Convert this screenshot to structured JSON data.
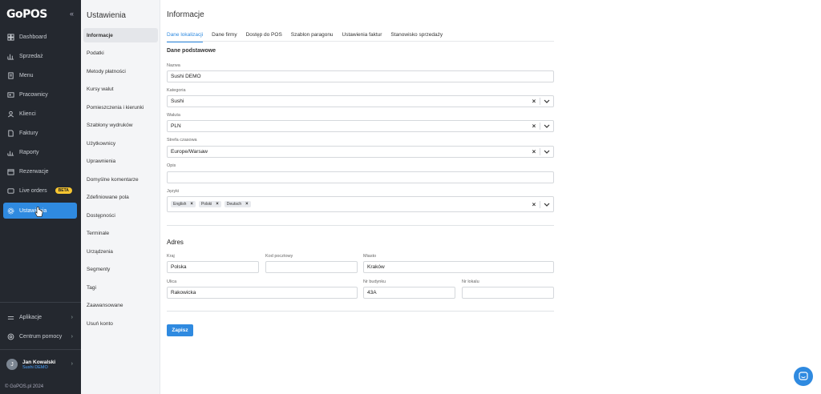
{
  "brand": {
    "logo": "GoPOS",
    "collapse": "«"
  },
  "nav": {
    "items": [
      {
        "label": "Dashboard",
        "icon": "dashboard-icon"
      },
      {
        "label": "Sprzedaż",
        "icon": "chart-icon"
      },
      {
        "label": "Menu",
        "icon": "menu-icon"
      },
      {
        "label": "Pracownicy",
        "icon": "users-icon"
      },
      {
        "label": "Klienci",
        "icon": "user-icon"
      },
      {
        "label": "Faktury",
        "icon": "invoice-icon"
      },
      {
        "label": "Raporty",
        "icon": "report-icon"
      },
      {
        "label": "Rezerwacje",
        "icon": "calendar-icon"
      },
      {
        "label": "Live orders",
        "icon": "orders-icon",
        "badge": "BETA"
      },
      {
        "label": "Ustawienia",
        "icon": "gear-icon",
        "active": true
      }
    ],
    "bottom": [
      {
        "label": "Aplikacje",
        "icon": "apps-icon"
      },
      {
        "label": "Centrum pomocy",
        "icon": "help-icon"
      }
    ],
    "user": {
      "initial": "J",
      "name": "Jan Kowalski",
      "org": "Sushi DEMO"
    },
    "copyright": "© GoPOS.pl 2024"
  },
  "settings_menu": {
    "title": "Ustawienia",
    "items": [
      "Informacje",
      "Podatki",
      "Metody płatności",
      "Kursy walut",
      "Pomieszczenia i kierunki",
      "Szablony wydruków",
      "Użytkownicy",
      "Uprawnienia",
      "Domyślne komentarze",
      "Zdefiniowane pola",
      "Dostępności",
      "Terminale",
      "Urządzenia",
      "Segmenty",
      "Tagi",
      "Zaawansowane",
      "Usuń konto"
    ]
  },
  "page": {
    "title": "Informacje",
    "tabs": [
      "Dane lokalizacji",
      "Dane firmy",
      "Dostęp do POS",
      "Szablon paragonu",
      "Ustawienia faktur",
      "Stanowisko sprzedaży"
    ],
    "basic": {
      "heading": "Dane podstawowe",
      "name_label": "Nazwa",
      "name_value": "Sushi DEMO",
      "category_label": "Kategoria",
      "category_value": "Sushi",
      "currency_label": "Waluta",
      "currency_value": "PLN",
      "timezone_label": "Strefa czasowa",
      "timezone_value": "Europe/Warsaw",
      "desc_label": "Opis",
      "desc_value": "",
      "languages_label": "Języki",
      "languages": [
        "English",
        "Polski",
        "Deutsch"
      ]
    },
    "address": {
      "heading": "Adres",
      "country_label": "Kraj",
      "country_value": "Polska",
      "zip_label": "Kod pocztowy",
      "zip_value": "",
      "city_label": "Miasto",
      "city_value": "Kraków",
      "street_label": "Ulica",
      "street_value": "Rakowicka",
      "building_label": "Nr budynku",
      "building_value": "43A",
      "flat_label": "Nr lokalu",
      "flat_value": ""
    },
    "save_label": "Zapisz"
  },
  "colors": {
    "accent": "#2f8ae0",
    "sidebar": "#24282f",
    "beta": "#f6c531"
  }
}
